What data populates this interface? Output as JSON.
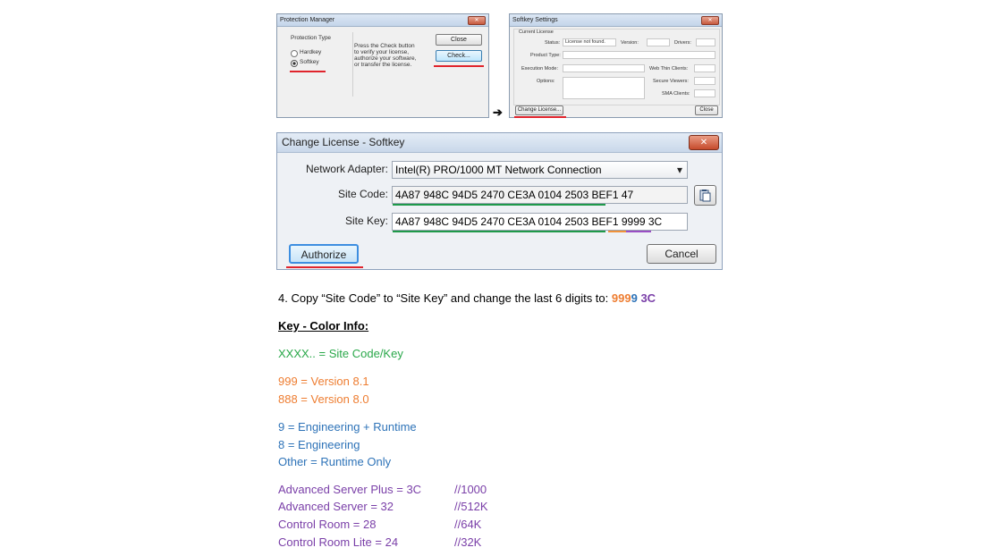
{
  "protection_manager": {
    "title": "Protection Manager",
    "close_glyph": "✕",
    "group_label": "Protection Type",
    "radio_hardkey": "Hardkey",
    "radio_softkey": "Softkey",
    "description": [
      "Press the Check button",
      "to verify your license,",
      "authorize your software,",
      "or transfer the license."
    ],
    "close_button": "Close",
    "check_button": "Check..."
  },
  "arrow": "➔",
  "softkey_settings": {
    "title": "Softkey Settings",
    "close_glyph": "✕",
    "current_license": "Current License",
    "status_label": "Status:",
    "status_value": "License not found.",
    "version_label": "Version:",
    "drivers_label": "Drivers:",
    "product_type_label": "Product Type:",
    "execution_mode_label": "Execution Mode:",
    "web_thin_clients_label": "Web Thin Clients:",
    "options_label": "Options:",
    "secure_viewers_label": "Secure Viewers:",
    "sma_clients_label": "SMA Clients:",
    "change_license_button": "Change License...",
    "close_button": "Close"
  },
  "change_license": {
    "title": "Change License - Softkey",
    "close_glyph": "✕",
    "network_adapter_label": "Network Adapter:",
    "network_adapter_value": "Intel(R) PRO/1000 MT Network Connection",
    "dropdown_glyph": "▾",
    "site_code_label": "Site Code:",
    "site_code_value": "4A87 948C 94D5 2470 CE3A 0104 2503 BEF1 47",
    "site_key_label": "Site Key:",
    "site_key_value": "4A87 948C 94D5 2470 CE3A 0104 2503 BEF1 9999 3C",
    "authorize_button": "Authorize",
    "cancel_button": "Cancel"
  },
  "instructions": {
    "step_prefix": "4. Copy “Site Code” to “Site Key” and change the last 6 digits to: ",
    "step_code_version": "999",
    "step_code_edition": "9",
    "step_code_tier": "3C",
    "key_heading": "Key - Color Info:",
    "site_code_key": "XXXX.. = Site Code/Key",
    "version_81": "999 = Version 8.1",
    "version_80": "888 = Version 8.0",
    "engineering_runtime": "9 = Engineering + Runtime",
    "engineering": "8 = Engineering",
    "runtime_only": "Other = Runtime Only",
    "tiers": [
      {
        "name": "Advanced Server Plus = 3C",
        "comment": "//1000"
      },
      {
        "name": "Advanced Server = 32",
        "comment": "//512K"
      },
      {
        "name": "Control Room = 28",
        "comment": "//64K"
      },
      {
        "name": "Control Room Lite = 24",
        "comment": "//32K"
      }
    ]
  },
  "colors": {
    "green": "#2aa84a",
    "orange": "#ee7d31",
    "blue": "#2e73b8",
    "purple": "#7a3fa8",
    "highlight_red": "#e0242c"
  }
}
